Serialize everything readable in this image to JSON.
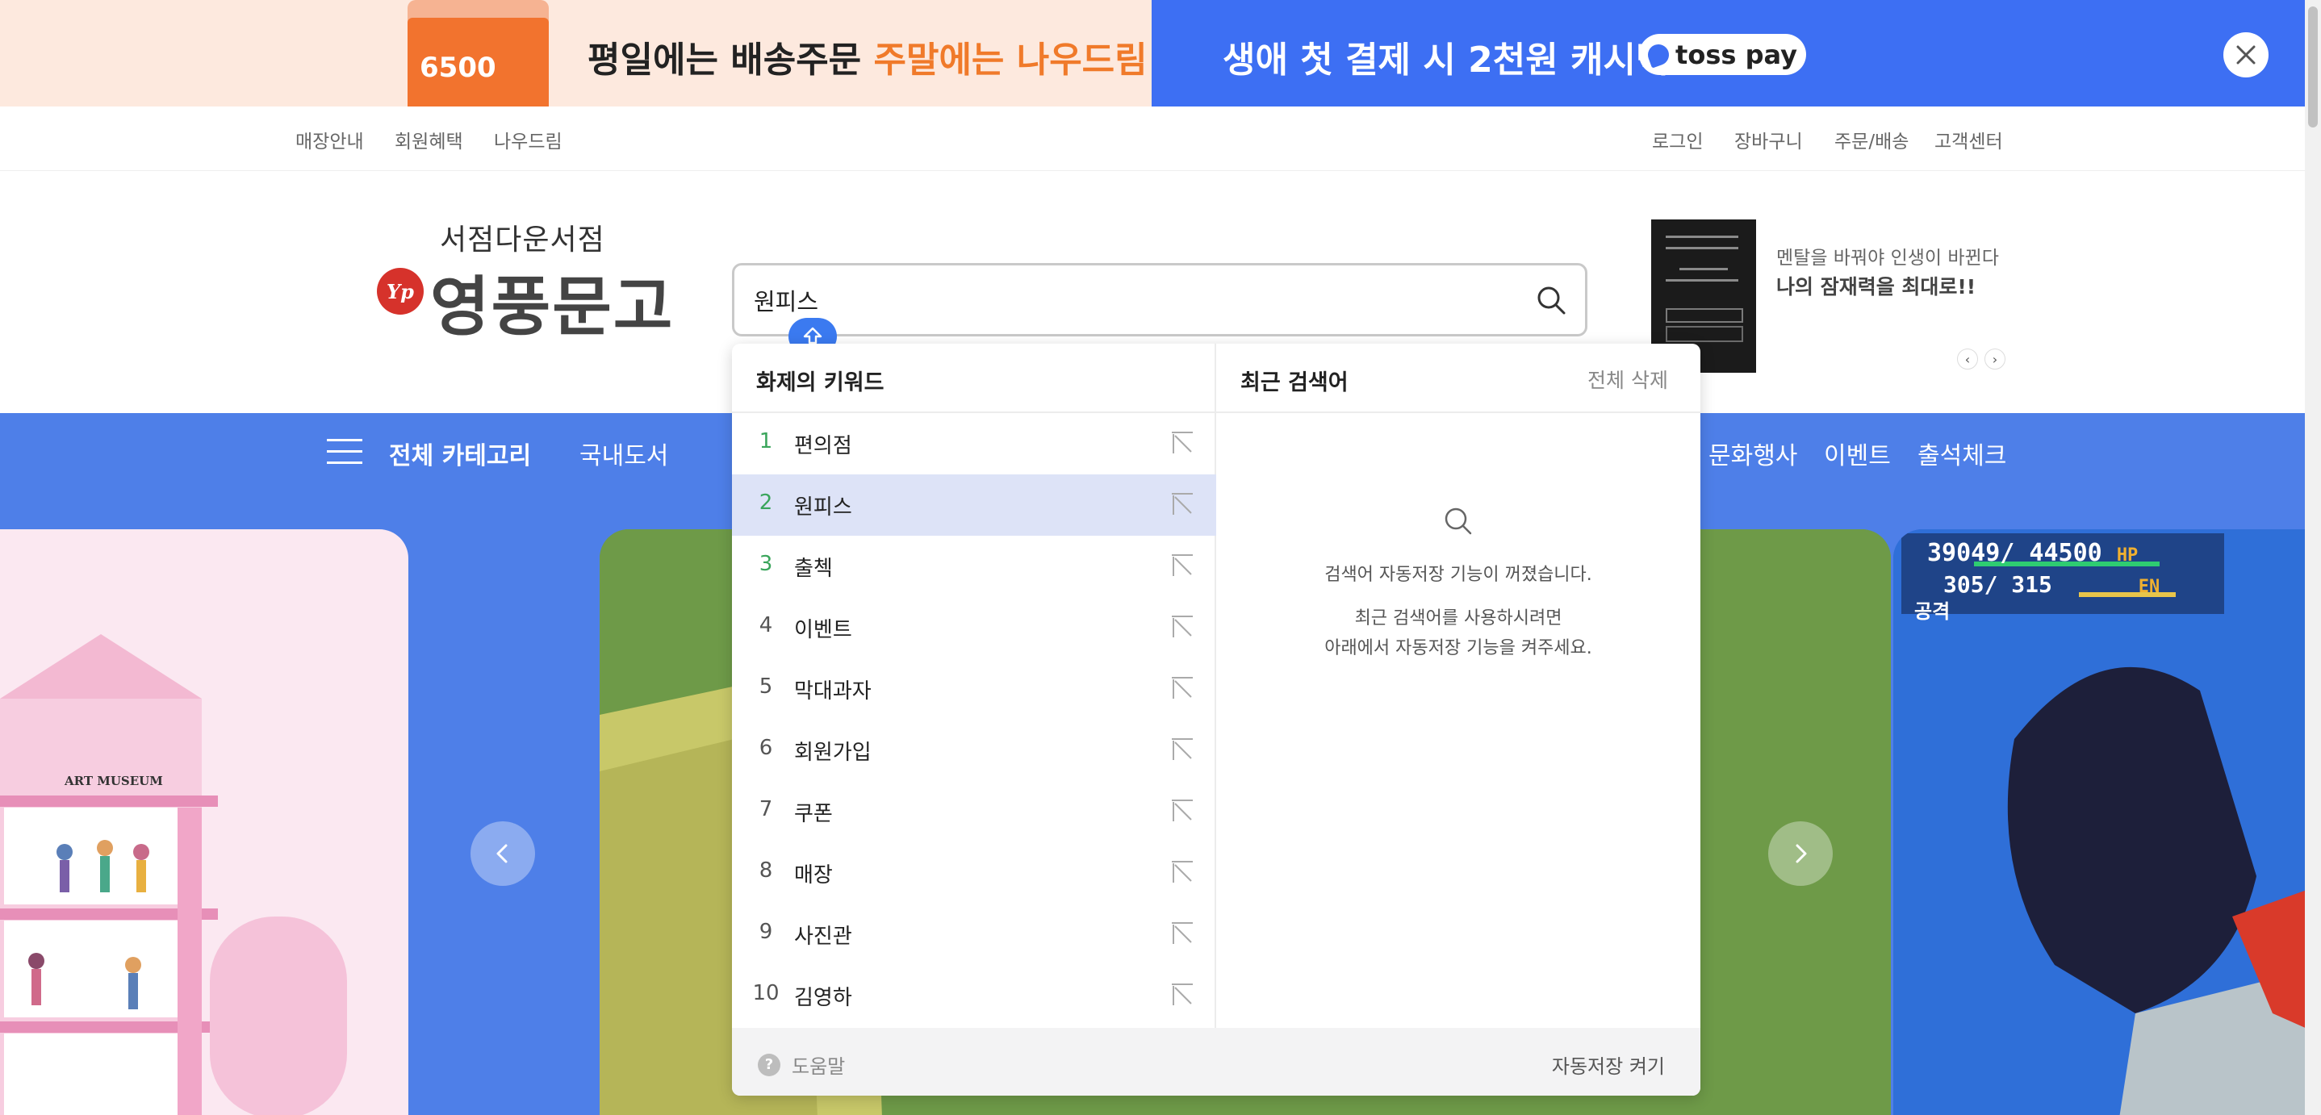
{
  "banner": {
    "envelope_price": "6500",
    "text_prefix": "평일에는 배송주문 ",
    "text_highlight": "주말에는 나우드림",
    "cashback_text": "생애 첫 결제 시 2천원 캐시백!",
    "tosspay_label": "toss pay",
    "colors": {
      "left_bg": "#fde9de",
      "right_bg": "#3d6ff3",
      "highlight": "#f07a2a"
    }
  },
  "util_nav": {
    "left": [
      "매장안내",
      "회원혜택",
      "나우드림"
    ],
    "right": [
      "로그인",
      "장바구니",
      "주문/배송",
      "고객센터"
    ]
  },
  "logo": {
    "sub": "서점다운서점",
    "main": "영풍문고",
    "badge": "Yp"
  },
  "search": {
    "value": "원피스",
    "icon": "search-icon"
  },
  "ad": {
    "subtitle": "멘탈을 바꿔야 인생이 바뀐다",
    "title": "나의 잠재력을 최대로!!",
    "prev": "‹",
    "next": "›"
  },
  "category_bar": {
    "all_label": "전체 카테고리",
    "items": [
      "국내도서",
      "문화행사",
      "이벤트",
      "출석체크"
    ],
    "color": "#4e7fe8"
  },
  "dropdown": {
    "trending_title": "화제의 키워드",
    "recent_title": "최근 검색어",
    "delete_all": "전체 삭제",
    "keywords": [
      {
        "rank": "1",
        "text": "편의점"
      },
      {
        "rank": "2",
        "text": "원피스"
      },
      {
        "rank": "3",
        "text": "출첵"
      },
      {
        "rank": "4",
        "text": "이벤트"
      },
      {
        "rank": "5",
        "text": "막대과자"
      },
      {
        "rank": "6",
        "text": "회원가입"
      },
      {
        "rank": "7",
        "text": "쿠폰"
      },
      {
        "rank": "8",
        "text": "매장"
      },
      {
        "rank": "9",
        "text": "사진관"
      },
      {
        "rank": "10",
        "text": "김영하"
      }
    ],
    "selected_index": 1,
    "empty_line1": "검색어 자동저장 기능이 꺼졌습니다.",
    "empty_line2": "최근 검색어를 사용하시려면\n아래에서 자동저장 기능을 켜주세요.",
    "help_label": "도움말",
    "help_icon": "?",
    "autosave_label": "자동저장 켜기"
  },
  "card3_hud": {
    "hp": "39049/ 44500",
    "hp_label": "HP",
    "en": "305/ 315",
    "en_label": "EN",
    "attack": "공격"
  },
  "card1_sign": "ART MUSEUM"
}
